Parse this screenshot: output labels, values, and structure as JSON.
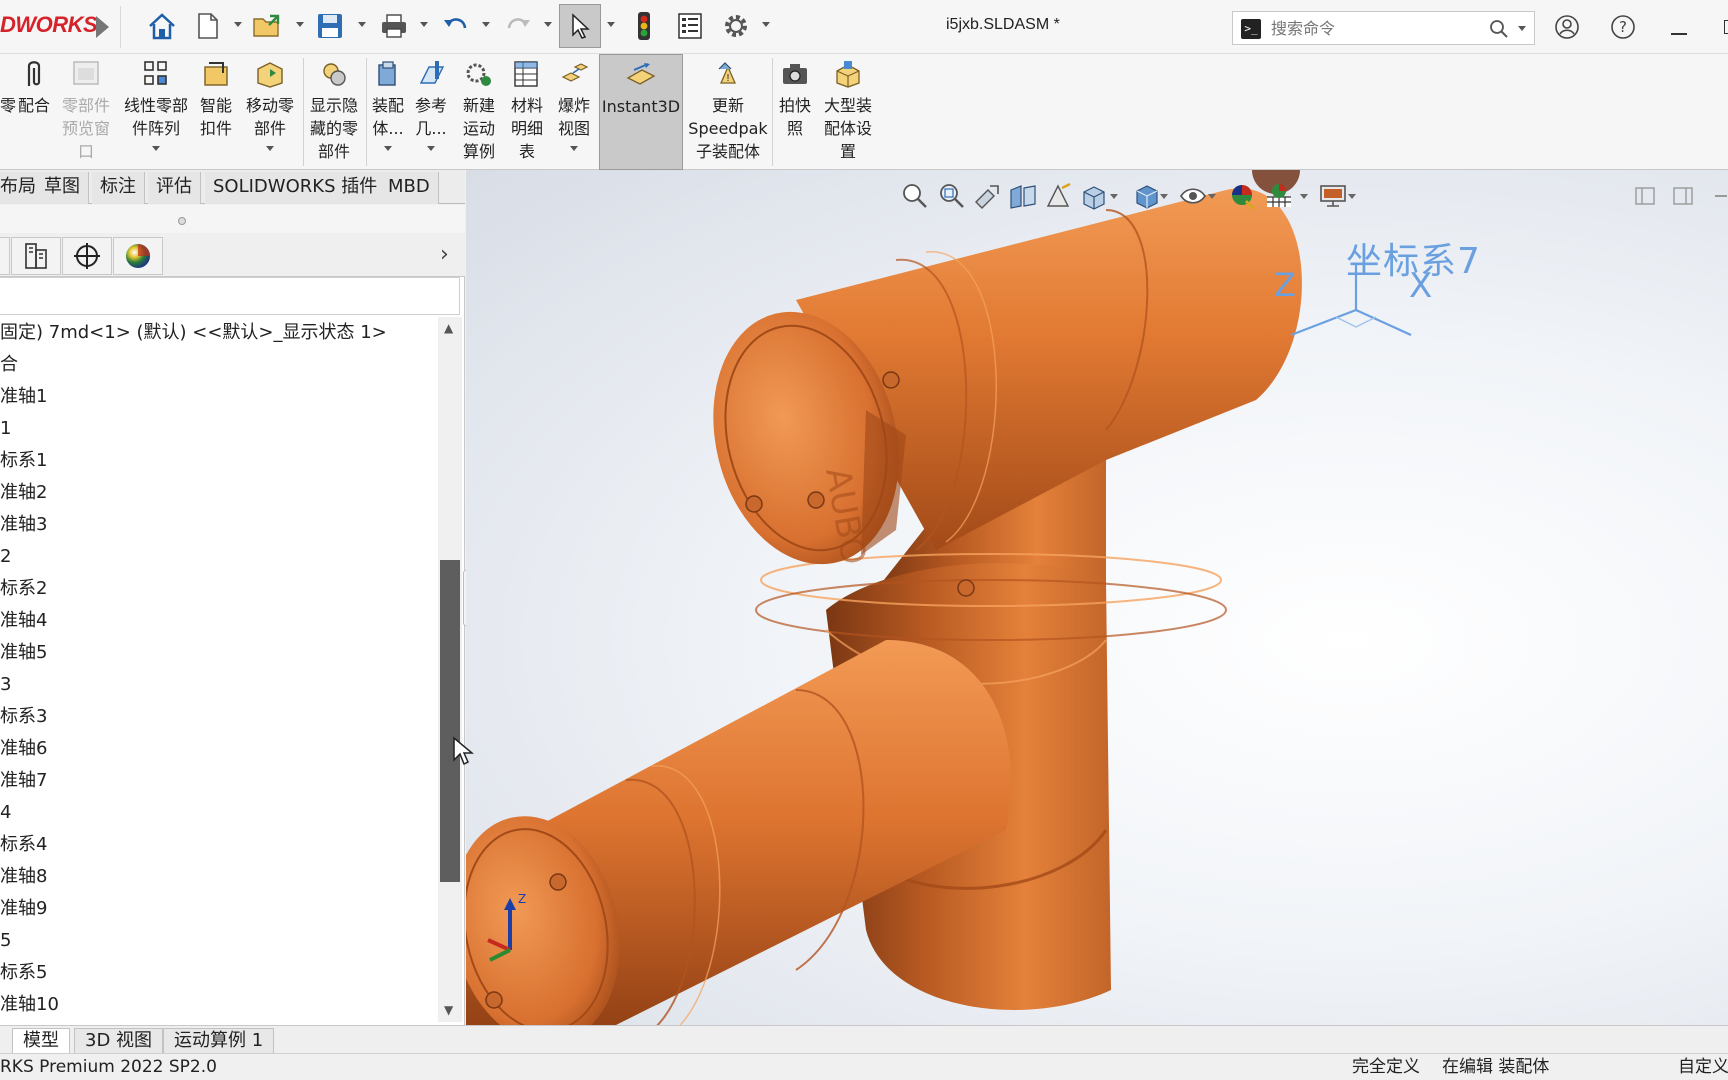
{
  "app": {
    "logo_text": "DWORKS",
    "document_title": "i5jxb.SLDASM *",
    "search_placeholder": "搜索命令"
  },
  "ribbon": {
    "items": [
      {
        "label": "零",
        "disabled": false
      },
      {
        "label": "配合",
        "disabled": false
      },
      {
        "label": "零部件\n预览窗\n口",
        "disabled": true
      },
      {
        "label": "线性零部\n件阵列",
        "disabled": false
      },
      {
        "label": "智能\n扣件",
        "disabled": false
      },
      {
        "label": "移动零\n部件",
        "disabled": false
      },
      {
        "label": "显示隐\n藏的零\n部件",
        "disabled": false
      },
      {
        "label": "装配\n体...",
        "disabled": false
      },
      {
        "label": "参考\n几...",
        "disabled": false
      },
      {
        "label": "新建\n运动\n算例",
        "disabled": false
      },
      {
        "label": "材料\n明细\n表",
        "disabled": false
      },
      {
        "label": "爆炸\n视图",
        "disabled": false
      },
      {
        "label": "Instant3D",
        "disabled": false
      },
      {
        "label": "更新\nSpeedpak\n子装配体",
        "disabled": false
      },
      {
        "label": "拍快\n照",
        "disabled": false
      },
      {
        "label": "大型装\n配体设\n置",
        "disabled": false
      }
    ]
  },
  "command_tabs": [
    "布局",
    "草图",
    "标注",
    "评估",
    "SOLIDWORKS 插件",
    "MBD"
  ],
  "feature_tree": {
    "rows": [
      "固定) 7md<1> (默认) <<默认>_显示状态 1>",
      "合",
      "准轴1",
      "1",
      "标系1",
      "准轴2",
      "准轴3",
      "2",
      "标系2",
      "准轴4",
      "准轴5",
      "3",
      "标系3",
      "准轴6",
      "准轴7",
      "4",
      "标系4",
      "准轴8",
      "准轴9",
      "5",
      "标系5",
      "准轴10"
    ]
  },
  "viewport": {
    "coord_label": "坐标系7",
    "axis_x": "X",
    "axis_z": "Z",
    "triad_z": "Z",
    "model_color": "#e0762f"
  },
  "bottom_tabs": [
    "模型",
    "3D 视图",
    "运动算例 1"
  ],
  "status": {
    "product": "RKS Premium 2022 SP2.0",
    "defined": "完全定义",
    "editing": "在编辑 装配体",
    "custom": "自定义"
  }
}
